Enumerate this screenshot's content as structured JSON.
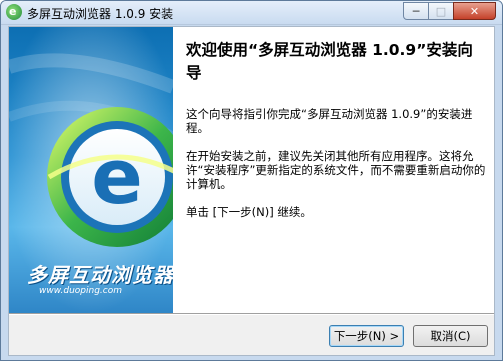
{
  "window": {
    "title": "多屏互动浏览器 1.0.9 安装",
    "icon_glyph": "e",
    "minimize_glyph": "─",
    "maximize_glyph": "□",
    "close_glyph": "✕"
  },
  "sidebar": {
    "brand_name": "多屏互动浏览器",
    "brand_url": "www.duoping.com",
    "logo_letter": "e",
    "colors": {
      "background": "#2a92d3",
      "ring": "#3cb54a",
      "letter": "#1a6fb5"
    }
  },
  "main": {
    "heading": "欢迎使用“多屏互动浏览器 1.0.9”安装向导",
    "paragraph1": "这个向导将指引你完成“多屏互动浏览器 1.0.9”的安装进程。",
    "paragraph2": "在开始安装之前，建议先关闭其他所有应用程序。这将允许“安装程序”更新指定的系统文件，而不需要重新启动你的计算机。",
    "paragraph3": "单击 [下一步(N)] 继续。"
  },
  "buttons": {
    "next_label": "下一步(N) >",
    "cancel_label": "取消(C)"
  }
}
